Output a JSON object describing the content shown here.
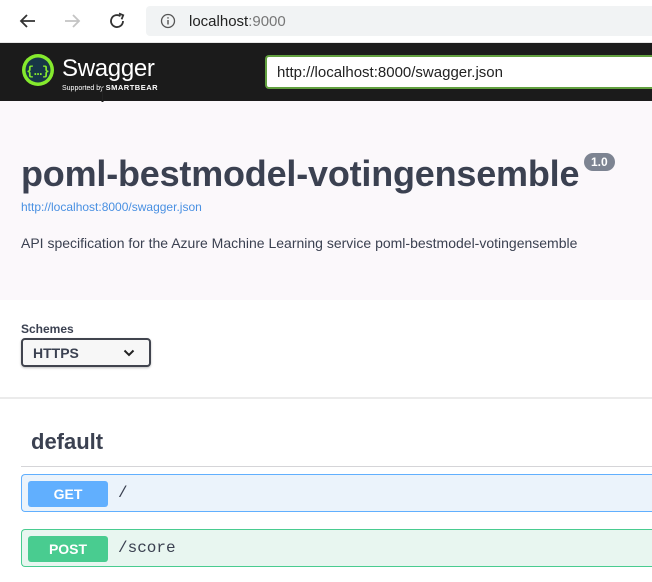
{
  "browser": {
    "address_host": "localhost",
    "address_port": ":9000"
  },
  "topbar": {
    "logo_text": "Swagger",
    "logo_sub_prefix": "Supported by",
    "logo_sub_brand": "SMARTBEAR",
    "spec_url": "http://localhost:8000/swagger.json"
  },
  "info": {
    "title": "poml-bestmodel-votingensemble",
    "version": "1.0",
    "spec_link": "http://localhost:8000/swagger.json",
    "description": "API specification for the Azure Machine Learning service poml-bestmodel-votingensemble"
  },
  "schemes": {
    "label": "Schemes",
    "selected": "HTTPS"
  },
  "tag": {
    "name": "default"
  },
  "operations": [
    {
      "method": "GET",
      "path": "/"
    },
    {
      "method": "POST",
      "path": "/score"
    }
  ],
  "colors": {
    "get": "#61affe",
    "post": "#49cc90",
    "topbar": "#1b1b1b",
    "url_border": "#62a03f"
  }
}
